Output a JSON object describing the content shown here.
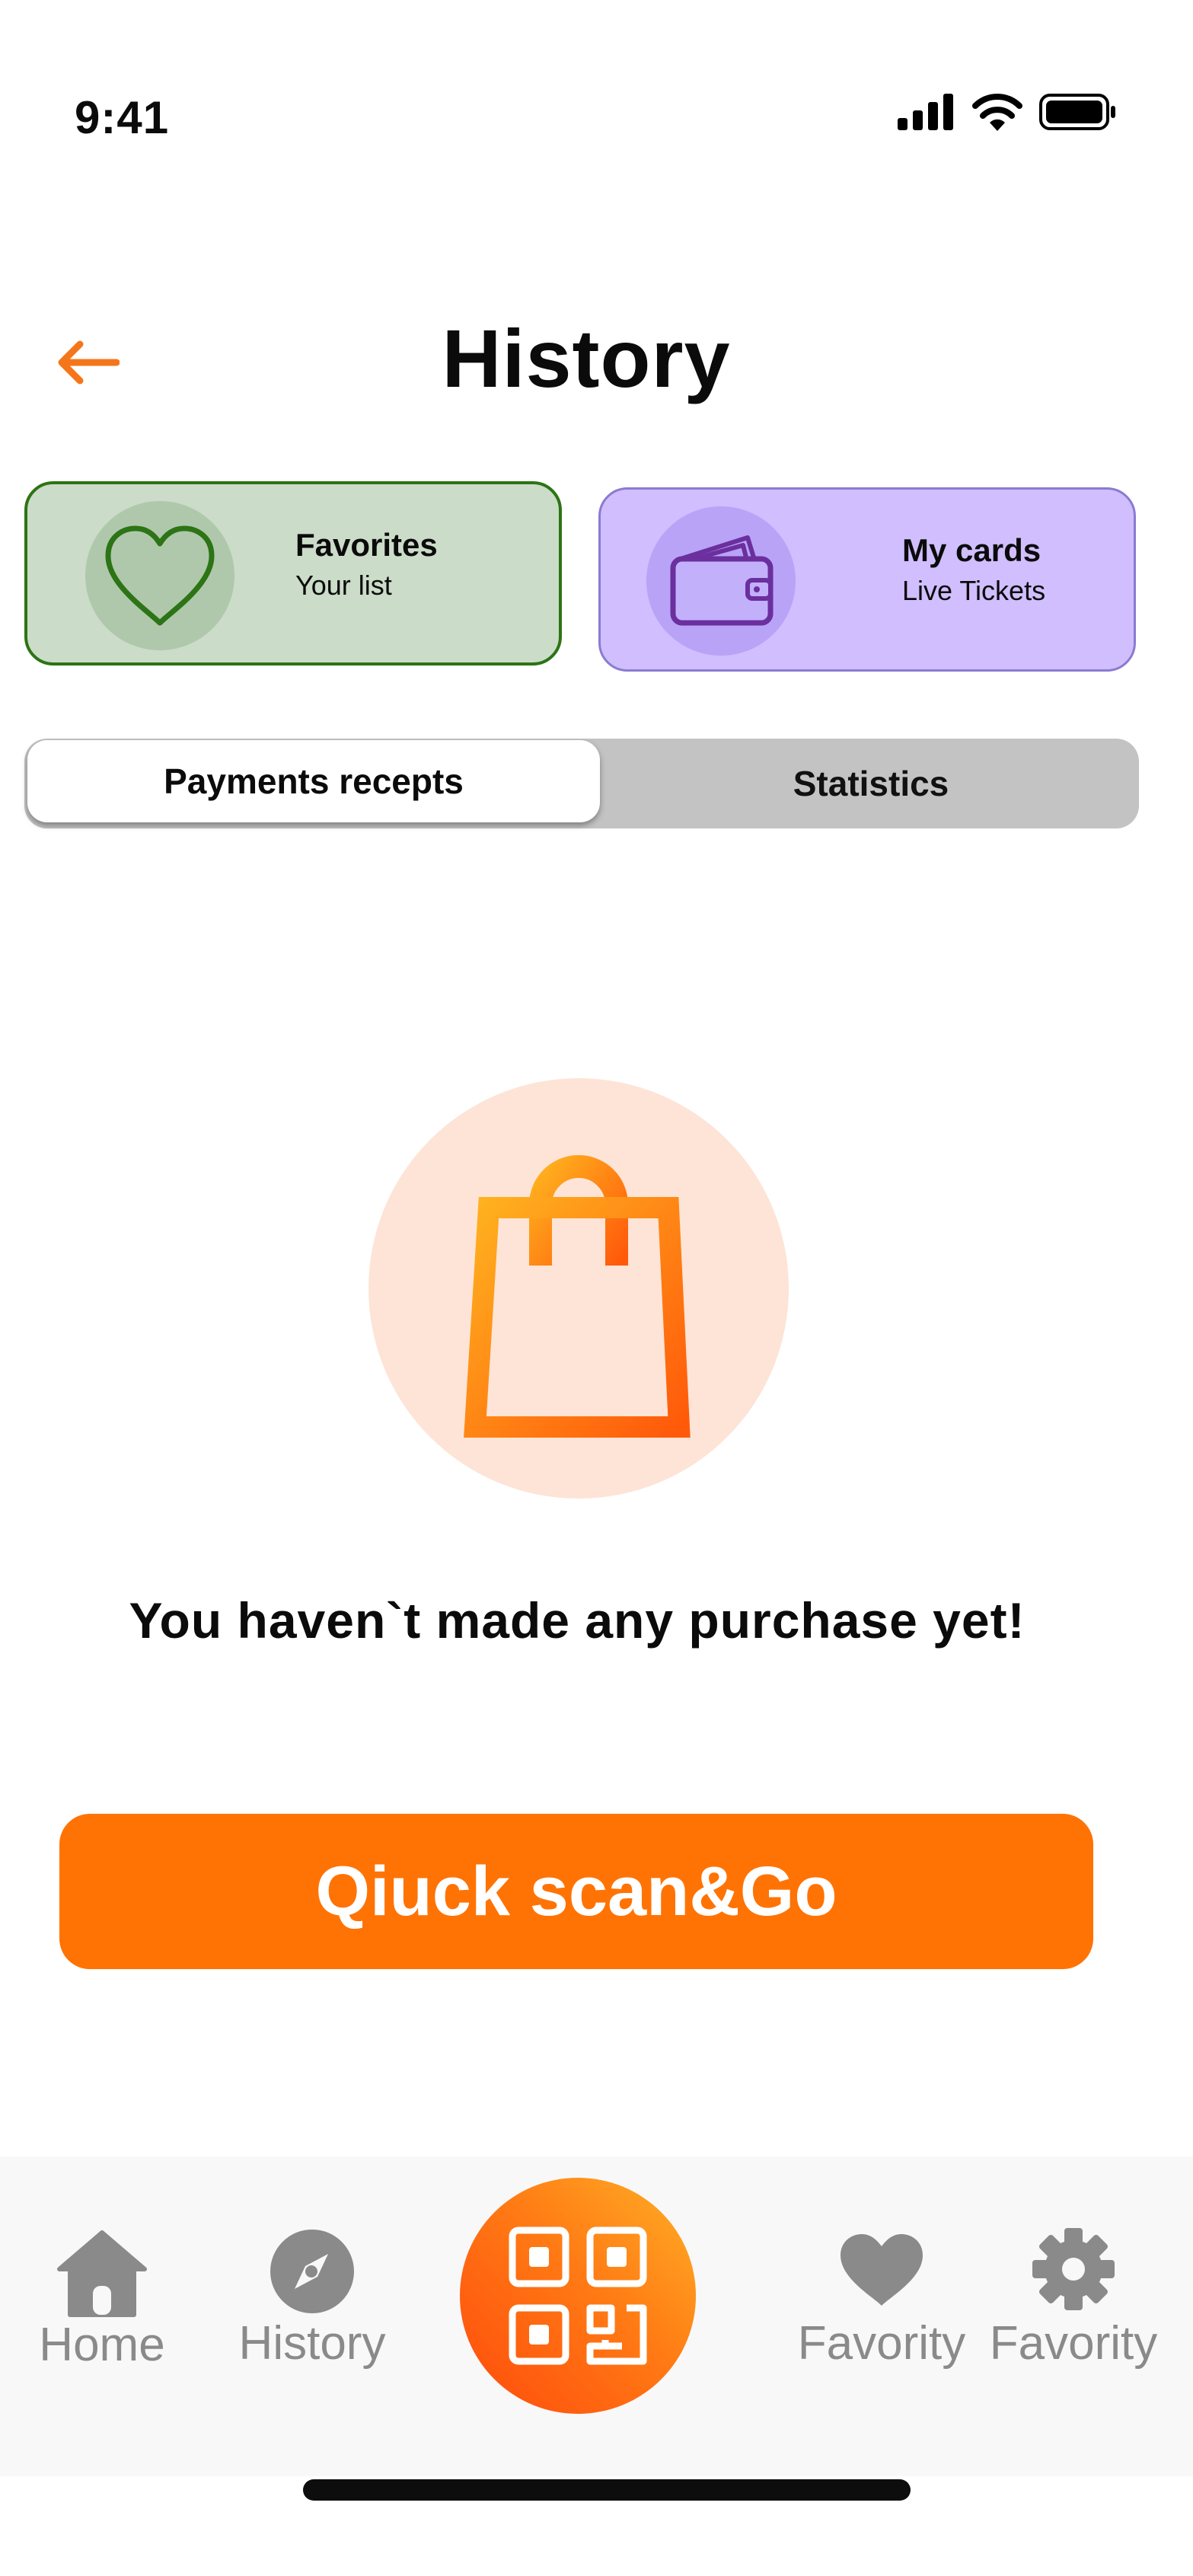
{
  "status_bar": {
    "time": "9:41",
    "icons": [
      "signal-icon",
      "wifi-icon",
      "battery-icon"
    ]
  },
  "header": {
    "title": "History",
    "back_icon": "arrow-left-icon",
    "accent": "#f5761a"
  },
  "quick_cards": [
    {
      "title": "Favorites",
      "subtitle": "Your list",
      "icon": "heart-icon",
      "color": "#2c7415"
    },
    {
      "title": "My cards",
      "subtitle": "Live Tickets",
      "icon": "wallet-icon",
      "color": "#6b2f9e"
    }
  ],
  "tabs": [
    {
      "label": "Payments recepts",
      "active": true
    },
    {
      "label": "Statistics",
      "active": false
    }
  ],
  "empty_state": {
    "icon": "shopping-bag-icon",
    "message": "You haven`t made any purchase yet!"
  },
  "primary_action": {
    "label": "Qiuck scan&Go",
    "color": "#ff7304"
  },
  "bottom_nav": {
    "items": [
      {
        "label": "Home",
        "icon": "home-icon"
      },
      {
        "label": "History",
        "icon": "compass-icon"
      },
      {
        "label": "",
        "icon": "qr-code-icon"
      },
      {
        "label": "Favority",
        "icon": "heart-icon"
      },
      {
        "label": "Favority",
        "icon": "gear-icon"
      }
    ]
  }
}
